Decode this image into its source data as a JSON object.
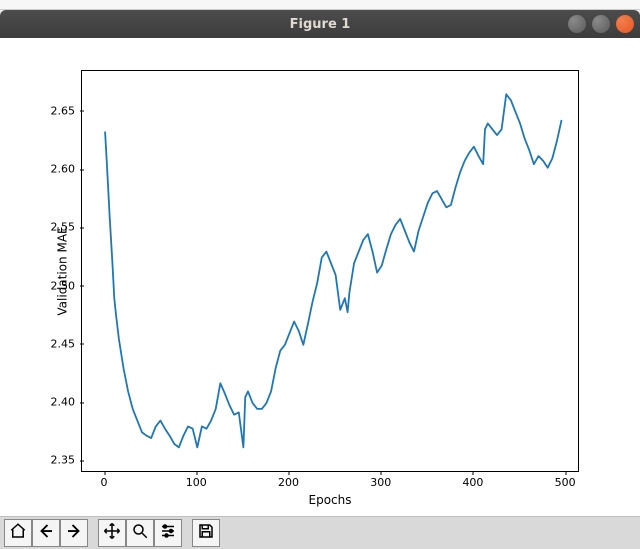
{
  "browser_remnant": "",
  "window": {
    "title": "Figure 1",
    "controls": {
      "minimize": "–",
      "maximize": "□",
      "close": "×"
    }
  },
  "chart_data": {
    "type": "line",
    "title": "",
    "xlabel": "Epochs",
    "ylabel": "Validation MAE",
    "xlim": [
      -25,
      515
    ],
    "ylim": [
      2.34,
      2.685
    ],
    "xticks": [
      0,
      100,
      200,
      300,
      400,
      500
    ],
    "yticks": [
      2.35,
      2.4,
      2.45,
      2.5,
      2.55,
      2.6,
      2.65
    ],
    "xtick_labels": [
      "0",
      "100",
      "200",
      "300",
      "400",
      "500"
    ],
    "ytick_labels": [
      "2.35",
      "2.40",
      "2.45",
      "2.50",
      "2.55",
      "2.60",
      "2.65"
    ],
    "series": [
      {
        "name": "Validation MAE",
        "color": "#1f77b4",
        "x": [
          0,
          2,
          5,
          8,
          10,
          12,
          15,
          18,
          20,
          25,
          30,
          35,
          40,
          45,
          50,
          55,
          60,
          65,
          70,
          75,
          80,
          85,
          90,
          95,
          100,
          105,
          110,
          115,
          120,
          125,
          130,
          135,
          140,
          145,
          150,
          152,
          155,
          160,
          165,
          170,
          175,
          180,
          185,
          190,
          195,
          200,
          205,
          210,
          215,
          220,
          225,
          230,
          235,
          240,
          245,
          250,
          255,
          260,
          263,
          265,
          270,
          275,
          280,
          285,
          290,
          295,
          300,
          305,
          310,
          315,
          320,
          325,
          330,
          335,
          340,
          345,
          350,
          355,
          360,
          365,
          370,
          375,
          380,
          385,
          390,
          395,
          400,
          405,
          410,
          412,
          415,
          420,
          425,
          430,
          435,
          440,
          445,
          450,
          455,
          460,
          465,
          470,
          475,
          480,
          485,
          490,
          495
        ],
        "values": [
          2.633,
          2.605,
          2.56,
          2.52,
          2.49,
          2.475,
          2.455,
          2.44,
          2.43,
          2.41,
          2.395,
          2.385,
          2.375,
          2.372,
          2.37,
          2.38,
          2.385,
          2.378,
          2.372,
          2.365,
          2.362,
          2.372,
          2.38,
          2.378,
          2.362,
          2.38,
          2.378,
          2.385,
          2.395,
          2.417,
          2.408,
          2.398,
          2.39,
          2.392,
          2.362,
          2.405,
          2.41,
          2.4,
          2.395,
          2.395,
          2.4,
          2.41,
          2.43,
          2.445,
          2.45,
          2.46,
          2.47,
          2.462,
          2.45,
          2.468,
          2.487,
          2.503,
          2.525,
          2.53,
          2.52,
          2.51,
          2.48,
          2.49,
          2.478,
          2.495,
          2.52,
          2.53,
          2.54,
          2.545,
          2.53,
          2.512,
          2.518,
          2.532,
          2.545,
          2.553,
          2.558,
          2.548,
          2.538,
          2.53,
          2.548,
          2.56,
          2.572,
          2.58,
          2.582,
          2.575,
          2.568,
          2.57,
          2.585,
          2.598,
          2.608,
          2.615,
          2.62,
          2.612,
          2.605,
          2.635,
          2.64,
          2.635,
          2.63,
          2.635,
          2.665,
          2.66,
          2.65,
          2.64,
          2.627,
          2.617,
          2.605,
          2.612,
          2.608,
          2.602,
          2.61,
          2.625,
          2.643
        ]
      }
    ]
  },
  "toolbar": {
    "home": "Home",
    "back": "Back",
    "forward": "Forward",
    "pan": "Pan",
    "zoom": "Zoom",
    "subplots": "Configure subplots",
    "save": "Save"
  }
}
